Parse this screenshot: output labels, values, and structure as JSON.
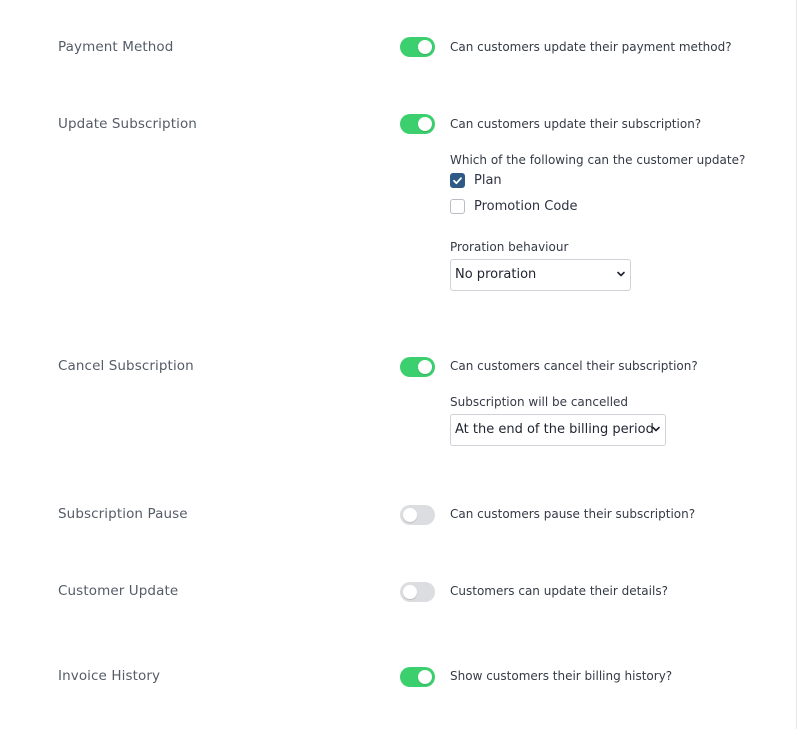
{
  "settings": [
    {
      "label": "Payment Method",
      "enabled": true,
      "question": "Can customers update their payment method?"
    },
    {
      "label": "Update Subscription",
      "enabled": true,
      "question": "Can customers update their subscription?"
    },
    {
      "label": "Cancel Subscription",
      "enabled": true,
      "question": "Can customers cancel their subscription?"
    },
    {
      "label": "Subscription Pause",
      "enabled": false,
      "question": "Can customers pause their subscription?"
    },
    {
      "label": "Customer Update",
      "enabled": false,
      "question": "Customers can update their details?"
    },
    {
      "label": "Invoice History",
      "enabled": true,
      "question": "Show customers their billing history?"
    }
  ],
  "update_subscription": {
    "options_prompt": "Which of the following can the customer update?",
    "options": [
      {
        "label": "Plan",
        "checked": true
      },
      {
        "label": "Promotion Code",
        "checked": false
      }
    ],
    "proration_label": "Proration behaviour",
    "proration_value": "No proration"
  },
  "cancel_subscription": {
    "timing_label": "Subscription will be cancelled",
    "timing_value": "At the end of the billing period"
  },
  "colors": {
    "toggle_on": "#3ccf6e",
    "toggle_off": "#dcdde0",
    "checkbox_checked": "#2e5a86"
  },
  "icons": {
    "check": "checkmark-icon",
    "select_arrow": "chevron-down-icon"
  }
}
